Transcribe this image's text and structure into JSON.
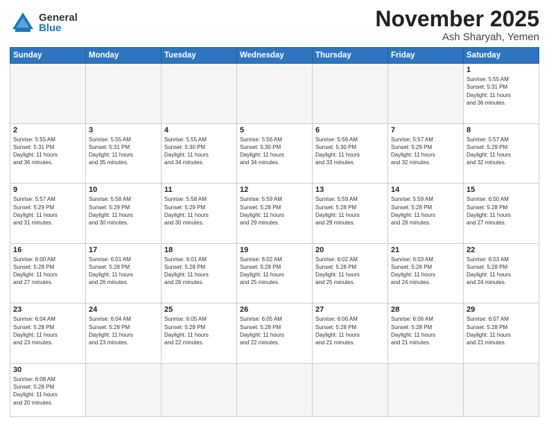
{
  "logo": {
    "general": "General",
    "blue": "Blue"
  },
  "header": {
    "month": "November 2025",
    "location": "Ash Sharyah, Yemen"
  },
  "weekdays": [
    "Sunday",
    "Monday",
    "Tuesday",
    "Wednesday",
    "Thursday",
    "Friday",
    "Saturday"
  ],
  "weeks": [
    [
      {
        "day": "",
        "info": ""
      },
      {
        "day": "",
        "info": ""
      },
      {
        "day": "",
        "info": ""
      },
      {
        "day": "",
        "info": ""
      },
      {
        "day": "",
        "info": ""
      },
      {
        "day": "",
        "info": ""
      },
      {
        "day": "1",
        "info": "Sunrise: 5:55 AM\nSunset: 5:31 PM\nDaylight: 11 hours\nand 36 minutes."
      }
    ],
    [
      {
        "day": "2",
        "info": "Sunrise: 5:55 AM\nSunset: 5:31 PM\nDaylight: 11 hours\nand 36 minutes."
      },
      {
        "day": "3",
        "info": "Sunrise: 5:55 AM\nSunset: 5:31 PM\nDaylight: 11 hours\nand 35 minutes."
      },
      {
        "day": "4",
        "info": "Sunrise: 5:55 AM\nSunset: 5:30 PM\nDaylight: 11 hours\nand 34 minutes."
      },
      {
        "day": "5",
        "info": "Sunrise: 5:56 AM\nSunset: 5:30 PM\nDaylight: 11 hours\nand 34 minutes."
      },
      {
        "day": "6",
        "info": "Sunrise: 5:56 AM\nSunset: 5:30 PM\nDaylight: 11 hours\nand 33 minutes."
      },
      {
        "day": "7",
        "info": "Sunrise: 5:57 AM\nSunset: 5:29 PM\nDaylight: 11 hours\nand 32 minutes."
      },
      {
        "day": "8",
        "info": "Sunrise: 5:57 AM\nSunset: 5:29 PM\nDaylight: 11 hours\nand 32 minutes."
      }
    ],
    [
      {
        "day": "9",
        "info": "Sunrise: 5:57 AM\nSunset: 5:29 PM\nDaylight: 11 hours\nand 31 minutes."
      },
      {
        "day": "10",
        "info": "Sunrise: 5:58 AM\nSunset: 5:29 PM\nDaylight: 11 hours\nand 30 minutes."
      },
      {
        "day": "11",
        "info": "Sunrise: 5:58 AM\nSunset: 5:29 PM\nDaylight: 11 hours\nand 30 minutes."
      },
      {
        "day": "12",
        "info": "Sunrise: 5:59 AM\nSunset: 5:28 PM\nDaylight: 11 hours\nand 29 minutes."
      },
      {
        "day": "13",
        "info": "Sunrise: 5:59 AM\nSunset: 5:28 PM\nDaylight: 11 hours\nand 29 minutes."
      },
      {
        "day": "14",
        "info": "Sunrise: 5:59 AM\nSunset: 5:28 PM\nDaylight: 11 hours\nand 28 minutes."
      },
      {
        "day": "15",
        "info": "Sunrise: 6:00 AM\nSunset: 5:28 PM\nDaylight: 11 hours\nand 27 minutes."
      }
    ],
    [
      {
        "day": "16",
        "info": "Sunrise: 6:00 AM\nSunset: 5:28 PM\nDaylight: 11 hours\nand 27 minutes."
      },
      {
        "day": "17",
        "info": "Sunrise: 6:01 AM\nSunset: 5:28 PM\nDaylight: 11 hours\nand 26 minutes."
      },
      {
        "day": "18",
        "info": "Sunrise: 6:01 AM\nSunset: 5:28 PM\nDaylight: 11 hours\nand 26 minutes."
      },
      {
        "day": "19",
        "info": "Sunrise: 6:02 AM\nSunset: 5:28 PM\nDaylight: 11 hours\nand 25 minutes."
      },
      {
        "day": "20",
        "info": "Sunrise: 6:02 AM\nSunset: 5:28 PM\nDaylight: 11 hours\nand 25 minutes."
      },
      {
        "day": "21",
        "info": "Sunrise: 6:03 AM\nSunset: 5:28 PM\nDaylight: 11 hours\nand 24 minutes."
      },
      {
        "day": "22",
        "info": "Sunrise: 6:03 AM\nSunset: 5:28 PM\nDaylight: 11 hours\nand 24 minutes."
      }
    ],
    [
      {
        "day": "23",
        "info": "Sunrise: 6:04 AM\nSunset: 5:28 PM\nDaylight: 11 hours\nand 23 minutes."
      },
      {
        "day": "24",
        "info": "Sunrise: 6:04 AM\nSunset: 5:28 PM\nDaylight: 11 hours\nand 23 minutes."
      },
      {
        "day": "25",
        "info": "Sunrise: 6:05 AM\nSunset: 5:28 PM\nDaylight: 11 hours\nand 22 minutes."
      },
      {
        "day": "26",
        "info": "Sunrise: 6:05 AM\nSunset: 5:28 PM\nDaylight: 11 hours\nand 22 minutes."
      },
      {
        "day": "27",
        "info": "Sunrise: 6:06 AM\nSunset: 5:28 PM\nDaylight: 11 hours\nand 21 minutes."
      },
      {
        "day": "28",
        "info": "Sunrise: 6:06 AM\nSunset: 5:28 PM\nDaylight: 11 hours\nand 21 minutes."
      },
      {
        "day": "29",
        "info": "Sunrise: 6:07 AM\nSunset: 5:28 PM\nDaylight: 11 hours\nand 21 minutes."
      }
    ],
    [
      {
        "day": "30",
        "info": "Sunrise: 6:08 AM\nSunset: 5:28 PM\nDaylight: 11 hours\nand 20 minutes."
      },
      {
        "day": "",
        "info": ""
      },
      {
        "day": "",
        "info": ""
      },
      {
        "day": "",
        "info": ""
      },
      {
        "day": "",
        "info": ""
      },
      {
        "day": "",
        "info": ""
      },
      {
        "day": "",
        "info": ""
      }
    ]
  ]
}
